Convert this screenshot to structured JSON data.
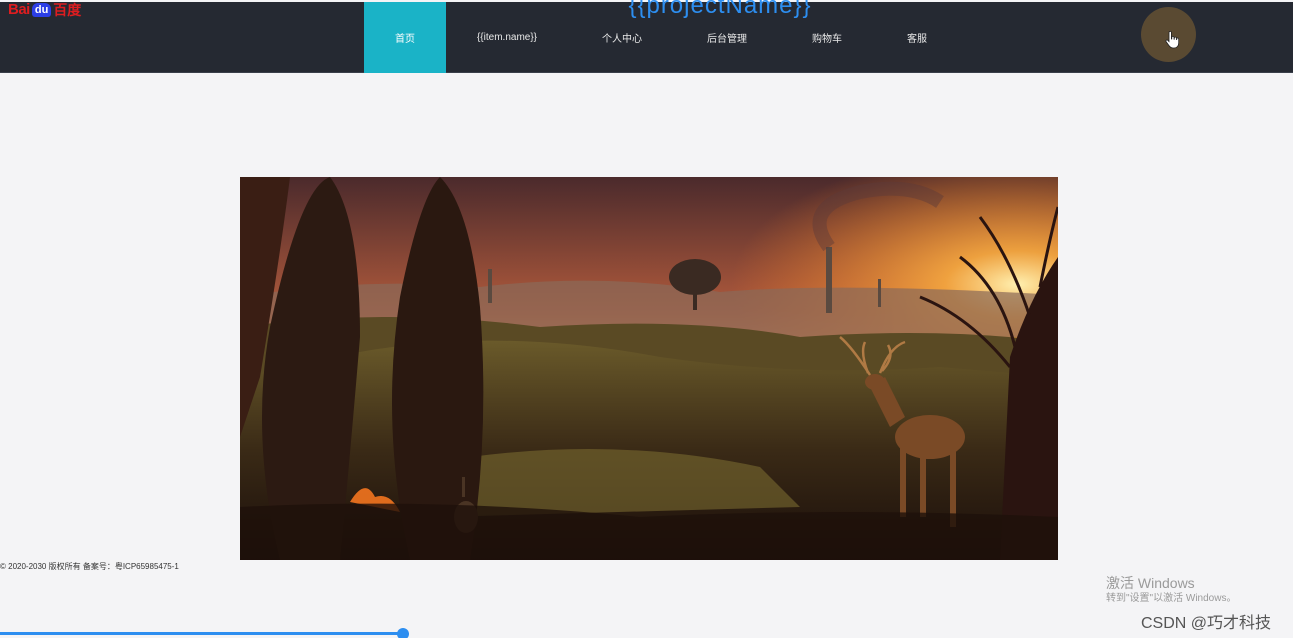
{
  "logo": {
    "part1": "Bai",
    "part2": "du",
    "part3": "百度"
  },
  "header": {
    "project_title": "{{projectName}}"
  },
  "nav": {
    "items": [
      {
        "label": "首页",
        "active": true
      },
      {
        "label": "{{item.name}}"
      },
      {
        "label": "个人中心"
      },
      {
        "label": "后台管理"
      },
      {
        "label": "购物车"
      },
      {
        "label": "客服"
      }
    ]
  },
  "footer": {
    "text": "© 2020-2030 版权所有 备案号：粤ICP65985475-1"
  },
  "watermark": {
    "line1": "激活 Windows",
    "line2": "转到\"设置\"以激活 Windows。",
    "csdn": "CSDN @巧才科技"
  },
  "icons": {
    "avatar": "hand-cursor-icon"
  },
  "colors": {
    "accent": "#1ab3c7",
    "nav_bg": "#252932",
    "title_blue": "#2d8ef0"
  }
}
